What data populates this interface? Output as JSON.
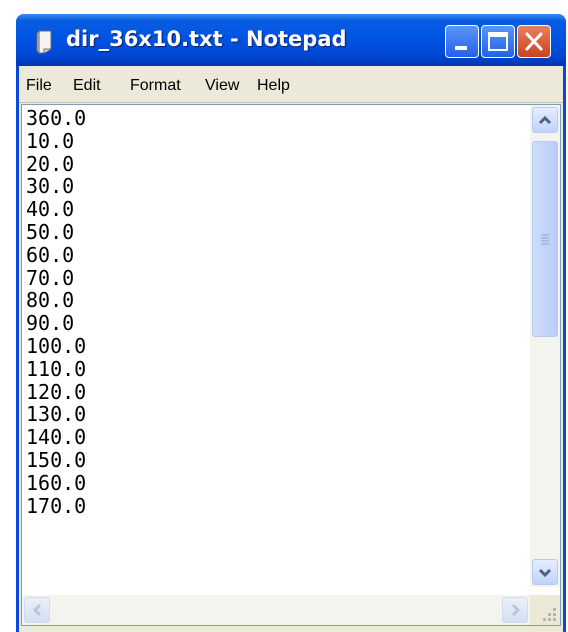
{
  "window": {
    "title": "dir_36x10.txt - Notepad",
    "titlebar_color": "#0055e5",
    "close_color": "#c8451d"
  },
  "menu": [
    "File",
    "Edit",
    "Format",
    "View",
    "Help"
  ],
  "document": {
    "content": "360.0\n10.0\n20.0\n30.0\n40.0\n50.0\n60.0\n70.0\n80.0\n90.0\n100.0\n110.0\n120.0\n130.0\n140.0\n150.0\n160.0\n170.0"
  },
  "icons": {
    "app": "notepad-icon",
    "minimize": "minimize-icon",
    "maximize": "maximize-icon",
    "close": "close-icon",
    "scroll_up": "arrow-up-icon",
    "scroll_down": "arrow-down-icon",
    "scroll_left": "arrow-left-icon",
    "scroll_right": "arrow-right-icon",
    "size_grip": "resize-grip-icon"
  }
}
